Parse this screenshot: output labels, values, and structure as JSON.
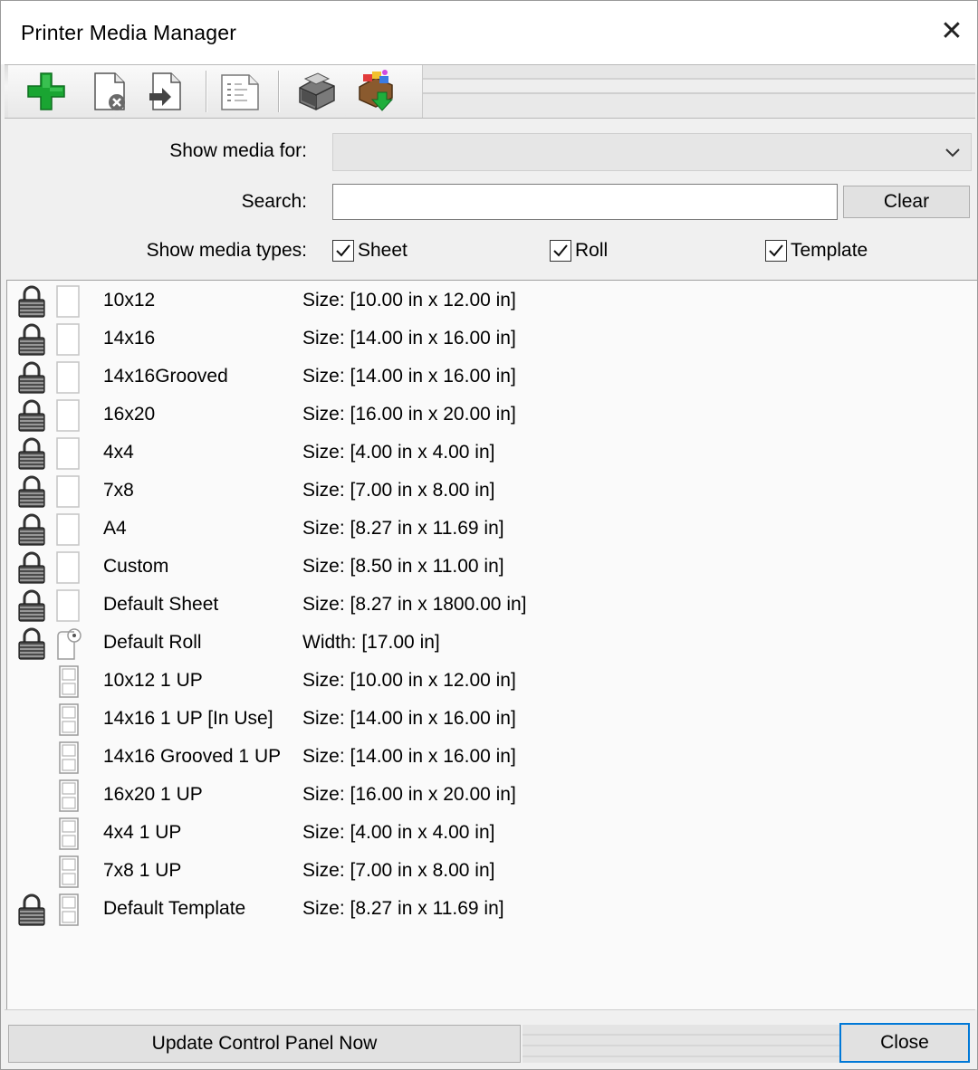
{
  "window": {
    "title": "Printer Media Manager"
  },
  "toolbar": {
    "buttons": [
      {
        "icon": "add-icon"
      },
      {
        "icon": "delete-media-icon"
      },
      {
        "icon": "import-media-icon"
      },
      {
        "icon": "properties-icon"
      },
      {
        "icon": "printer-settings-icon"
      },
      {
        "icon": "download-icon"
      }
    ]
  },
  "filters": {
    "show_media_for_label": "Show media for:",
    "show_media_for_value": "",
    "search_label": "Search:",
    "search_value": "",
    "clear_label": "Clear",
    "types_label": "Show media types:",
    "types": [
      {
        "label": "Sheet",
        "checked": true
      },
      {
        "label": "Roll",
        "checked": true
      },
      {
        "label": "Template",
        "checked": true
      }
    ]
  },
  "media": [
    {
      "name": "10x12",
      "size": "Size: [10.00 in x 12.00 in]",
      "locked": true,
      "kind": "sheet"
    },
    {
      "name": "14x16",
      "size": "Size: [14.00 in x 16.00 in]",
      "locked": true,
      "kind": "sheet"
    },
    {
      "name": "14x16Grooved",
      "size": "Size: [14.00 in x 16.00 in]",
      "locked": true,
      "kind": "sheet"
    },
    {
      "name": "16x20",
      "size": "Size: [16.00 in x 20.00 in]",
      "locked": true,
      "kind": "sheet"
    },
    {
      "name": "4x4",
      "size": "Size: [4.00 in x 4.00 in]",
      "locked": true,
      "kind": "sheet"
    },
    {
      "name": "7x8",
      "size": "Size: [7.00 in x 8.00 in]",
      "locked": true,
      "kind": "sheet"
    },
    {
      "name": "A4",
      "size": "Size: [8.27 in x 11.69 in]",
      "locked": true,
      "kind": "sheet"
    },
    {
      "name": "Custom",
      "size": "Size: [8.50 in x 11.00 in]",
      "locked": true,
      "kind": "sheet"
    },
    {
      "name": "Default Sheet",
      "size": "Size: [8.27 in x 1800.00 in]",
      "locked": true,
      "kind": "sheet"
    },
    {
      "name": "Default Roll",
      "size": "Width: [17.00 in]",
      "locked": true,
      "kind": "roll"
    },
    {
      "name": "10x12 1 UP",
      "size": "Size: [10.00 in x 12.00 in]",
      "locked": false,
      "kind": "template"
    },
    {
      "name": "14x16 1 UP [In Use]",
      "size": "Size: [14.00 in x 16.00 in]",
      "locked": false,
      "kind": "template"
    },
    {
      "name": "14x16 Grooved 1 UP",
      "size": "Size: [14.00 in x 16.00 in]",
      "locked": false,
      "kind": "template"
    },
    {
      "name": "16x20 1 UP",
      "size": "Size: [16.00 in x 20.00 in]",
      "locked": false,
      "kind": "template"
    },
    {
      "name": "4x4 1 UP",
      "size": "Size: [4.00 in x 4.00 in]",
      "locked": false,
      "kind": "template"
    },
    {
      "name": "7x8 1 UP",
      "size": "Size: [7.00 in x 8.00 in]",
      "locked": false,
      "kind": "template"
    },
    {
      "name": "Default Template",
      "size": "Size: [8.27 in x 11.69 in]",
      "locked": true,
      "kind": "template"
    }
  ],
  "footer": {
    "update_label": "Update Control Panel Now",
    "close_label": "Close"
  }
}
